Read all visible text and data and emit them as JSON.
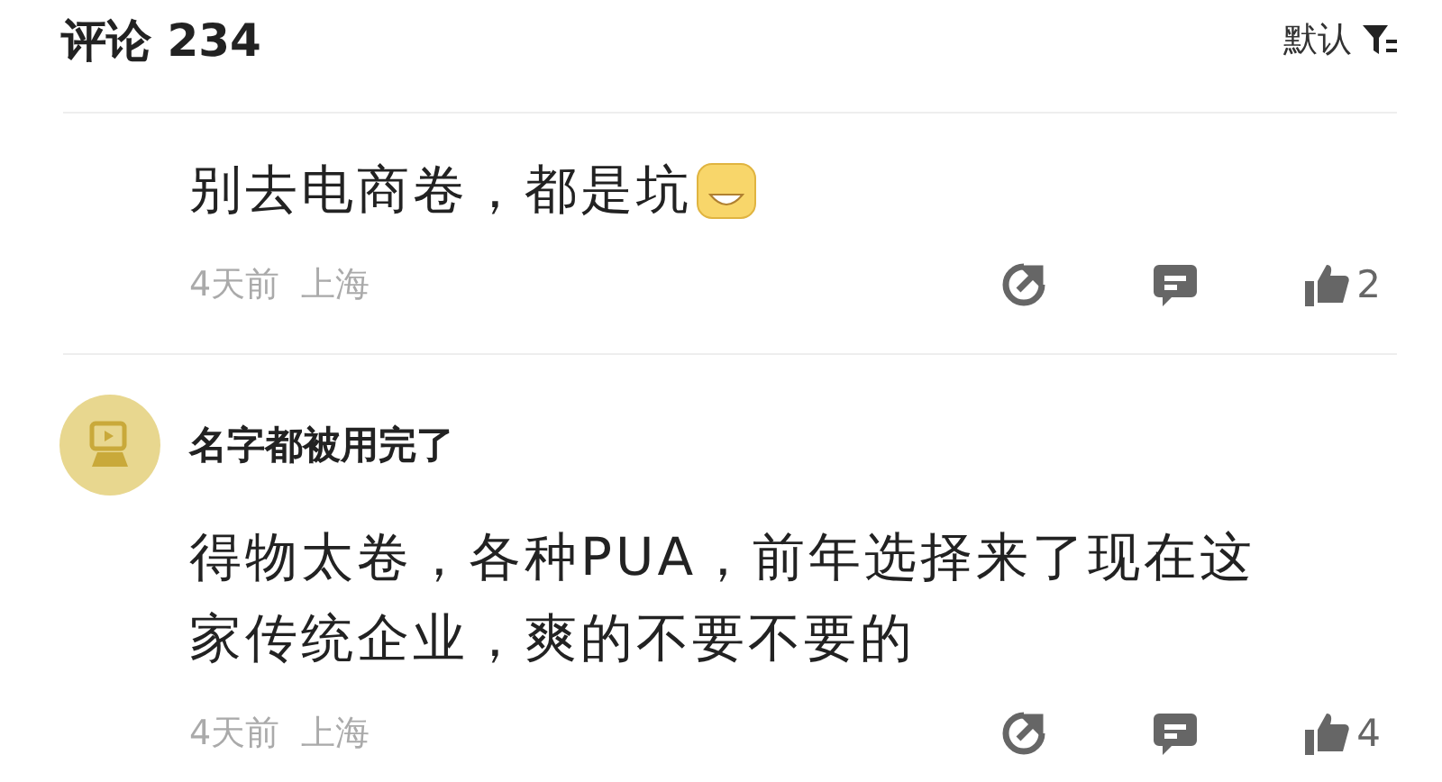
{
  "header": {
    "title": "评论 234",
    "sort": "默认"
  },
  "comments": [
    {
      "text": "别去电商卷，都是坑",
      "emoji": true,
      "time": "4天前",
      "location": "上海",
      "likes": "2"
    },
    {
      "author": "名字都被用完了",
      "text": "得物太卷，各种PUA，前年选择来了现在这家传统企业，爽的不要不要的",
      "emoji": false,
      "time": "4天前",
      "location": "上海",
      "likes": "4"
    }
  ]
}
